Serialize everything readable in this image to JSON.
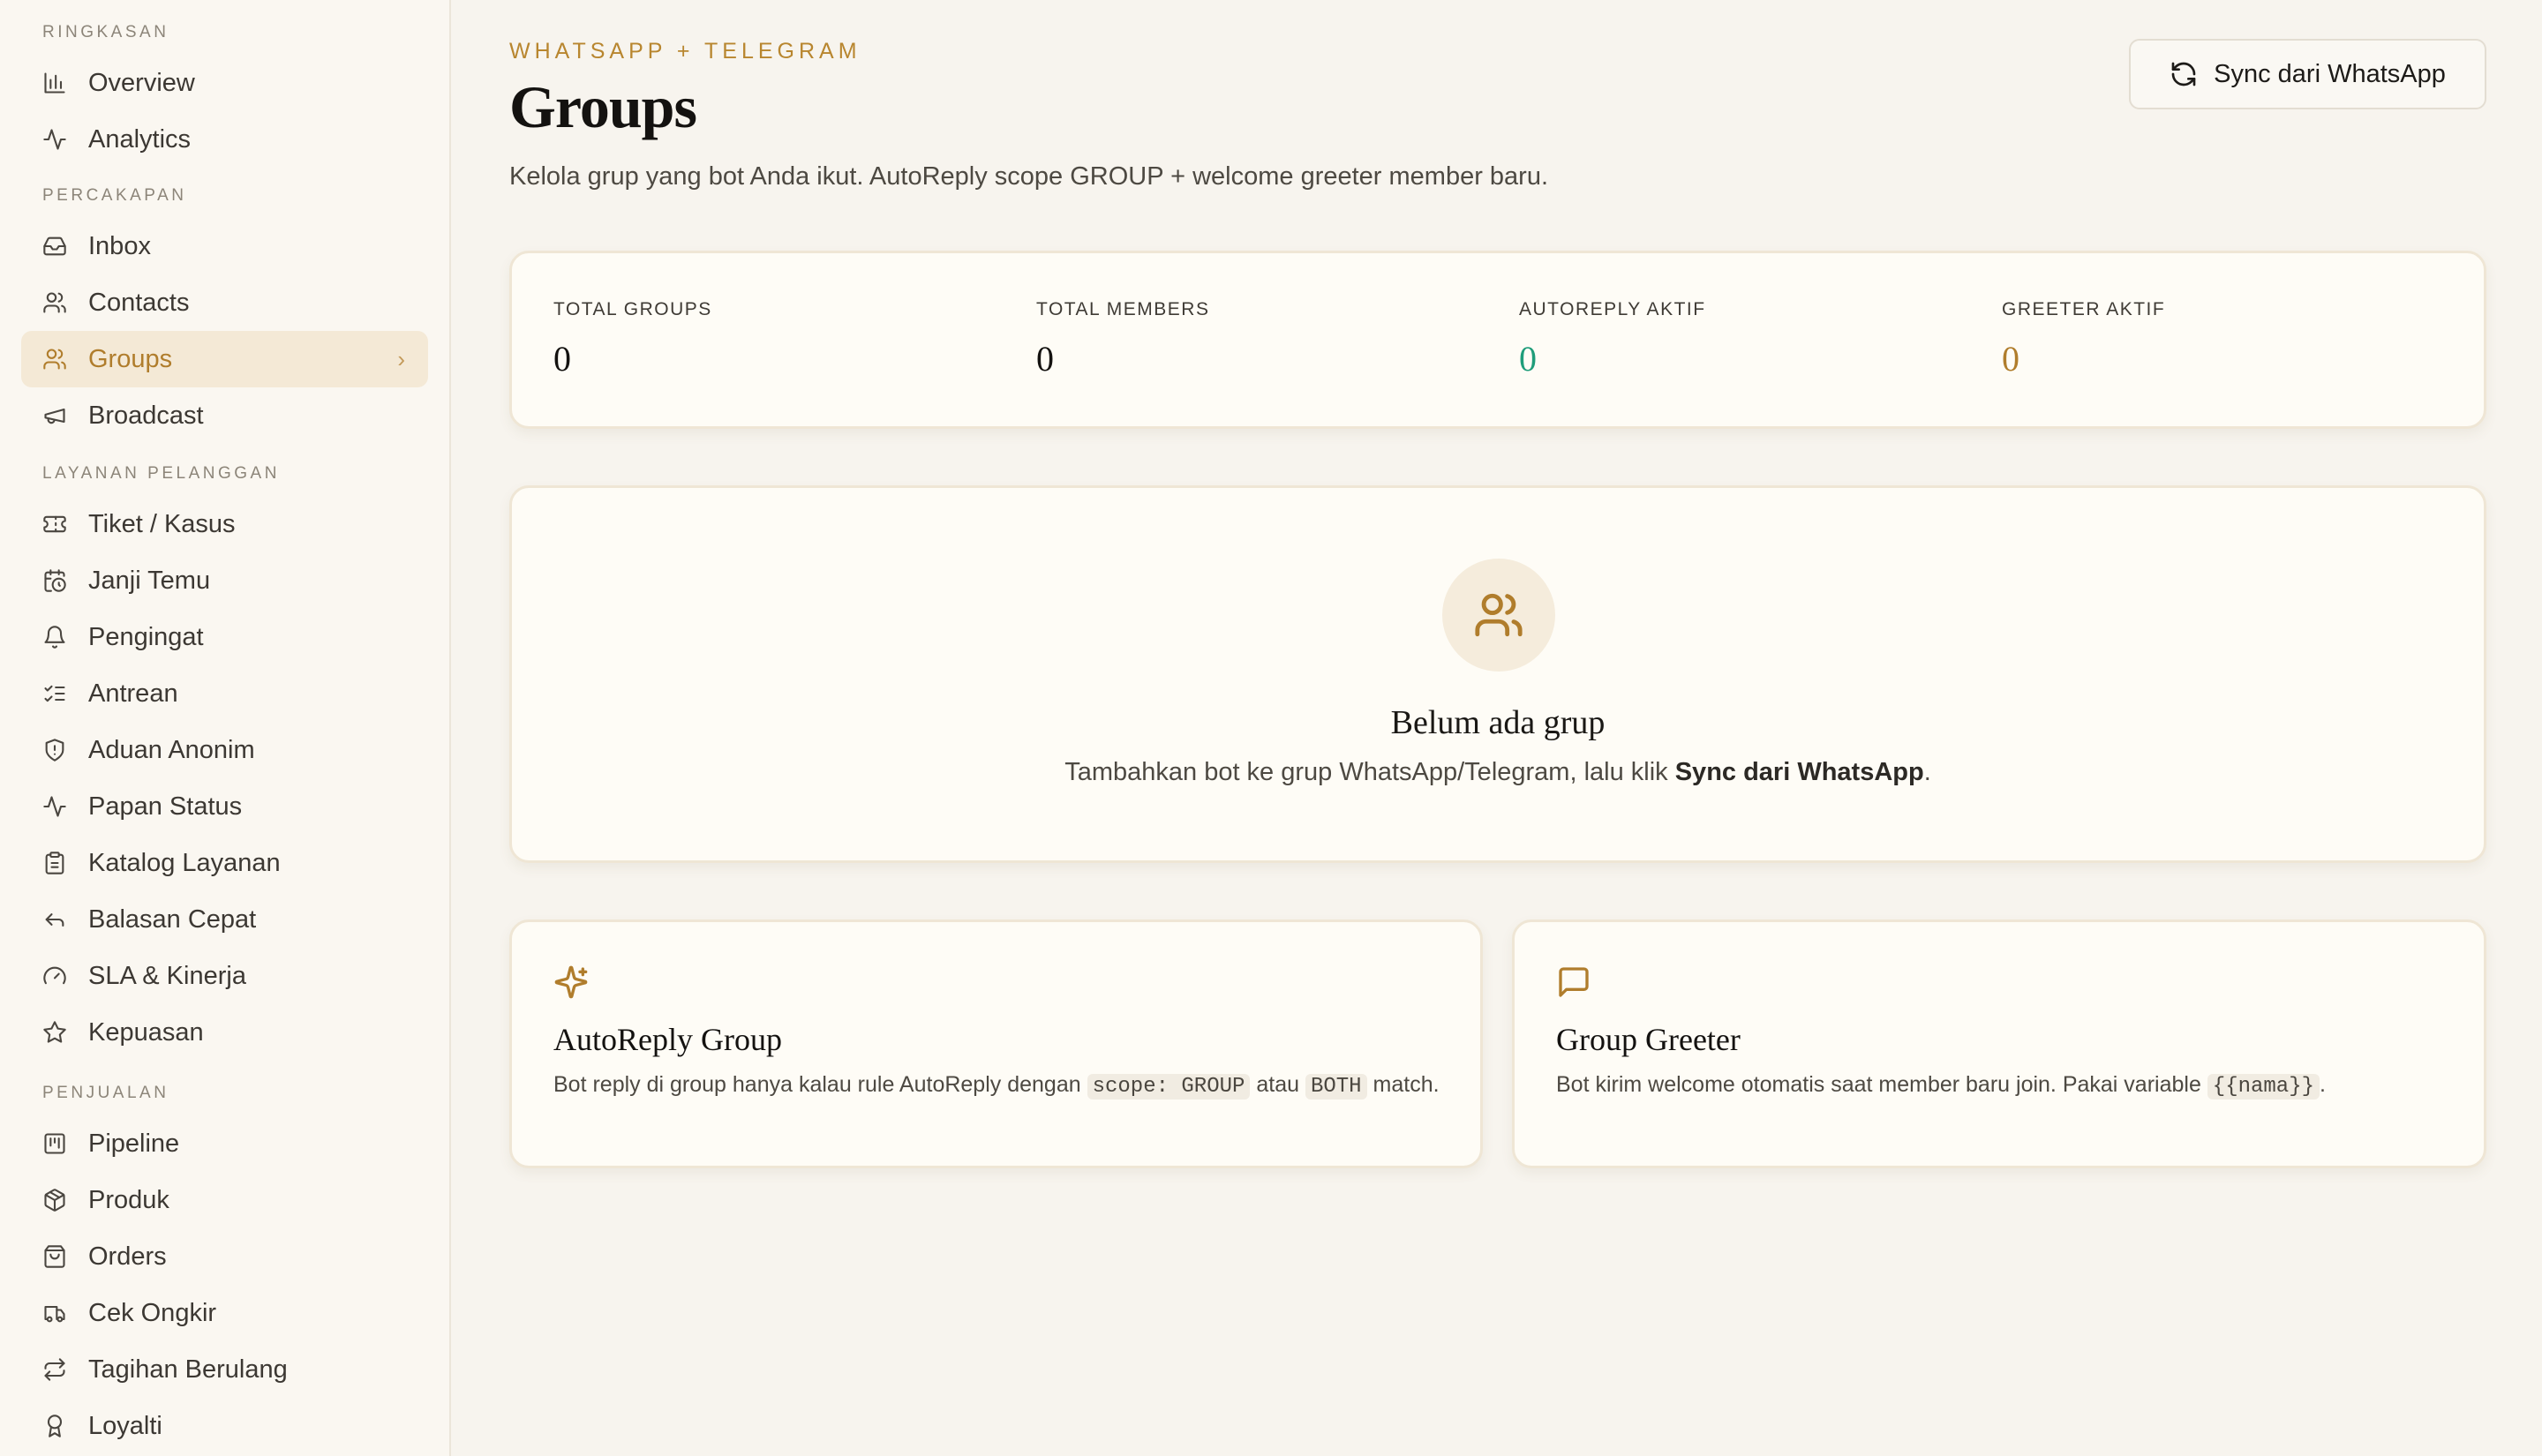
{
  "sidebar": {
    "sections": [
      {
        "label": "RINGKASAN",
        "items": [
          {
            "label": "Overview",
            "icon": "bar-chart-icon"
          },
          {
            "label": "Analytics",
            "icon": "activity-icon"
          }
        ]
      },
      {
        "label": "PERCAKAPAN",
        "items": [
          {
            "label": "Inbox",
            "icon": "inbox-icon"
          },
          {
            "label": "Contacts",
            "icon": "users-icon"
          },
          {
            "label": "Groups",
            "icon": "users-icon",
            "active": true
          },
          {
            "label": "Broadcast",
            "icon": "megaphone-icon"
          }
        ]
      },
      {
        "label": "LAYANAN PELANGGAN",
        "items": [
          {
            "label": "Tiket / Kasus",
            "icon": "ticket-icon"
          },
          {
            "label": "Janji Temu",
            "icon": "calendar-clock-icon"
          },
          {
            "label": "Pengingat",
            "icon": "bell-icon"
          },
          {
            "label": "Antrean",
            "icon": "list-checks-icon"
          },
          {
            "label": "Aduan Anonim",
            "icon": "shield-icon"
          },
          {
            "label": "Papan Status",
            "icon": "activity-icon"
          },
          {
            "label": "Katalog Layanan",
            "icon": "clipboard-icon"
          },
          {
            "label": "Balasan Cepat",
            "icon": "reply-icon"
          },
          {
            "label": "SLA & Kinerja",
            "icon": "gauge-icon"
          },
          {
            "label": "Kepuasan",
            "icon": "star-icon"
          }
        ]
      },
      {
        "label": "PENJUALAN",
        "items": [
          {
            "label": "Pipeline",
            "icon": "kanban-icon"
          },
          {
            "label": "Produk",
            "icon": "package-icon"
          },
          {
            "label": "Orders",
            "icon": "shopping-bag-icon"
          },
          {
            "label": "Cek Ongkir",
            "icon": "truck-icon"
          },
          {
            "label": "Tagihan Berulang",
            "icon": "repeat-icon"
          },
          {
            "label": "Loyalti",
            "icon": "award-icon"
          }
        ]
      }
    ]
  },
  "header": {
    "eyebrow": "WHATSAPP + TELEGRAM",
    "title": "Groups",
    "subtitle": "Kelola grup yang bot Anda ikut. AutoReply scope GROUP + welcome greeter member baru.",
    "sync_button": "Sync dari WhatsApp"
  },
  "stats": [
    {
      "label": "TOTAL GROUPS",
      "value": "0",
      "color": "#141210"
    },
    {
      "label": "TOTAL MEMBERS",
      "value": "0",
      "color": "#141210"
    },
    {
      "label": "AUTOREPLY AKTIF",
      "value": "0",
      "color": "#1f9d7a"
    },
    {
      "label": "GREETER AKTIF",
      "value": "0",
      "color": "#b07d2c"
    }
  ],
  "empty_state": {
    "title": "Belum ada grup",
    "desc_prefix": "Tambahkan bot ke grup WhatsApp/Telegram, lalu klik ",
    "desc_bold": "Sync dari WhatsApp",
    "desc_suffix": "."
  },
  "features": {
    "autoreply": {
      "title": "AutoReply Group",
      "desc_1": "Bot reply di group hanya kalau rule AutoReply dengan ",
      "code_1": "scope: GROUP",
      "desc_2": " atau ",
      "code_2": "BOTH",
      "desc_3": " match."
    },
    "greeter": {
      "title": "Group Greeter",
      "desc_1": "Bot kirim welcome otomatis saat member baru join. Pakai variable ",
      "code_1": "{{nama}}",
      "desc_2": "."
    }
  },
  "colors": {
    "accent": "#b07d2c",
    "success": "#1f9d7a",
    "active_bg": "#f4e9d6"
  }
}
